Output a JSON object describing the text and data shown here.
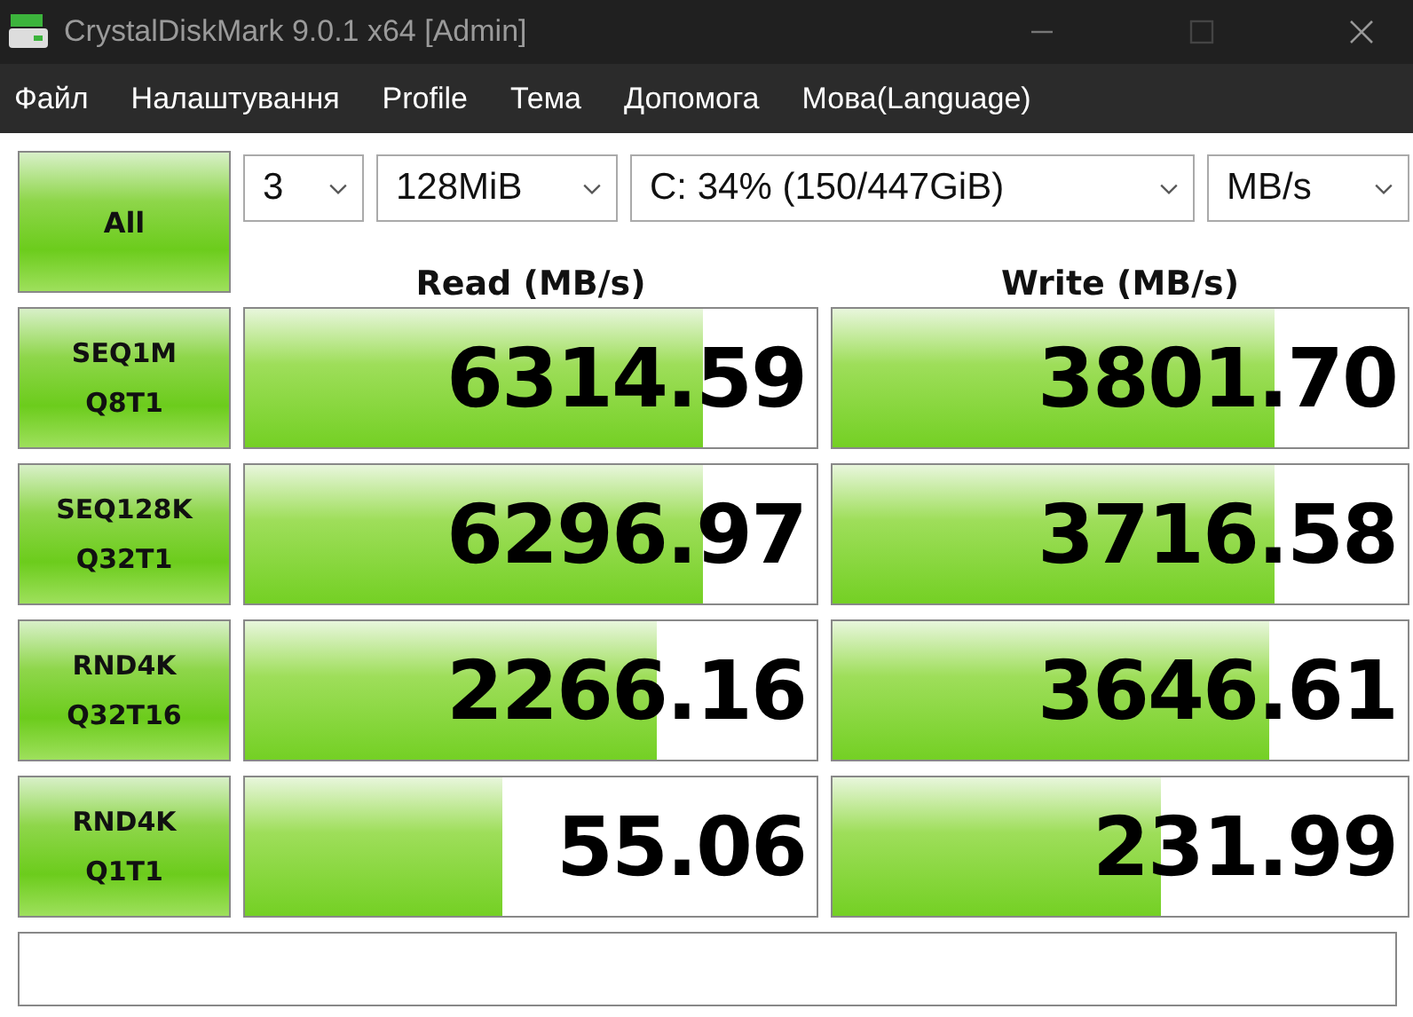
{
  "window": {
    "title": "CrystalDiskMark 9.0.1 x64 [Admin]"
  },
  "menu": [
    "Файл",
    "Налаштування",
    "Profile",
    "Тема",
    "Допомога",
    "Мова(Language)"
  ],
  "all_button": "All",
  "selects": [
    {
      "value": "3"
    },
    {
      "value": "128MiB"
    },
    {
      "value": "C: 34% (150/447GiB)"
    },
    {
      "value": "MB/s"
    }
  ],
  "columns": [
    "Read (MB/s)",
    "Write (MB/s)"
  ],
  "rows": [
    {
      "label": [
        "SEQ1M",
        "Q8T1"
      ],
      "read": {
        "value": "6314.59",
        "level": 0.8
      },
      "write": {
        "value": "3801.70",
        "level": 0.77
      }
    },
    {
      "label": [
        "SEQ128K",
        "Q32T1"
      ],
      "read": {
        "value": "6296.97",
        "level": 0.8
      },
      "write": {
        "value": "3716.58",
        "level": 0.77
      }
    },
    {
      "label": [
        "RND4K",
        "Q32T16"
      ],
      "read": {
        "value": "2266.16",
        "level": 0.72
      },
      "write": {
        "value": "3646.61",
        "level": 0.76
      }
    },
    {
      "label": [
        "RND4K",
        "Q1T1"
      ],
      "read": {
        "value": "55.06",
        "level": 0.45
      },
      "write": {
        "value": "231.99",
        "level": 0.57
      }
    }
  ]
}
